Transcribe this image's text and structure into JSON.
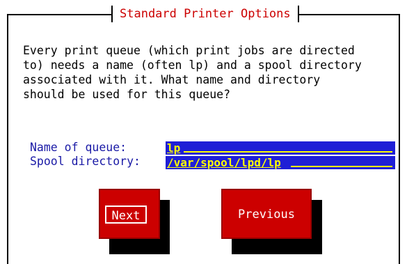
{
  "dialog": {
    "title": "Standard Printer Options",
    "description": "Every print queue (which print jobs are directed\nto) needs a name (often lp) and a spool directory\nassociated with it. What name and directory\nshould be used for this queue?"
  },
  "form": {
    "queue_label": "Name of queue:",
    "queue_value": "lp",
    "spool_label": "Spool directory:",
    "spool_value": "/var/spool/lpd/lp"
  },
  "buttons": {
    "next": "Next",
    "previous": "Previous"
  },
  "colors": {
    "title": "#cc0000",
    "label": "#1a1aa6",
    "field_bg": "#1f1fd6",
    "field_text": "#ffff00",
    "button": "#cc0000"
  }
}
